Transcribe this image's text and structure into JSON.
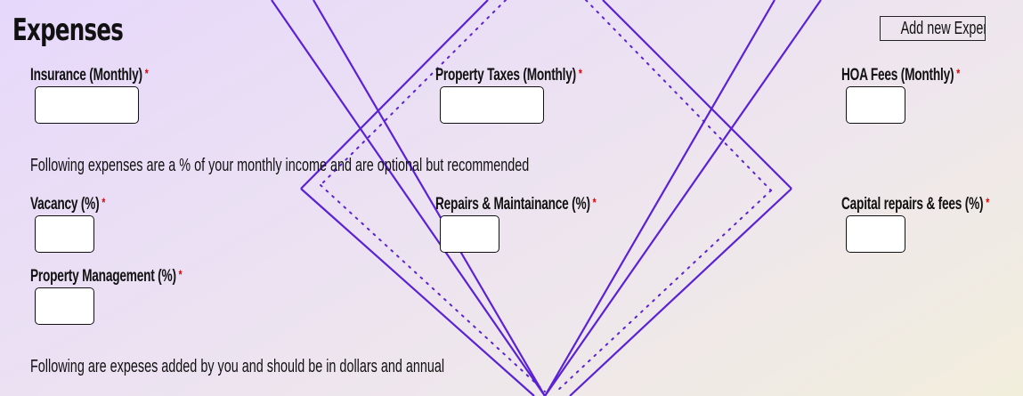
{
  "section": {
    "title": "Expenses",
    "add_button_label": "Add new Expense"
  },
  "fields": {
    "insurance": {
      "label": "Insurance (Monthly)",
      "value": ""
    },
    "property_taxes": {
      "label": "Property Taxes (Monthly)",
      "value": ""
    },
    "hoa_fees": {
      "label": "HOA Fees (Monthly)",
      "value": ""
    },
    "vacancy": {
      "label": "Vacancy (%)",
      "value": ""
    },
    "repairs": {
      "label": "Repairs & Maintainance (%)",
      "value": ""
    },
    "capital_repairs": {
      "label": "Capital repairs & fees (%)",
      "value": ""
    },
    "property_management": {
      "label": "Property Management (%)",
      "value": ""
    }
  },
  "required_marker": "*",
  "notes": {
    "percent_info": "Following expenses are a % of your monthly income and are optional but recommended",
    "custom_info": "Following are expeses added by you and should be in dollars and annual"
  },
  "colors": {
    "accent": "#5b21d6",
    "required": "#e00000"
  }
}
